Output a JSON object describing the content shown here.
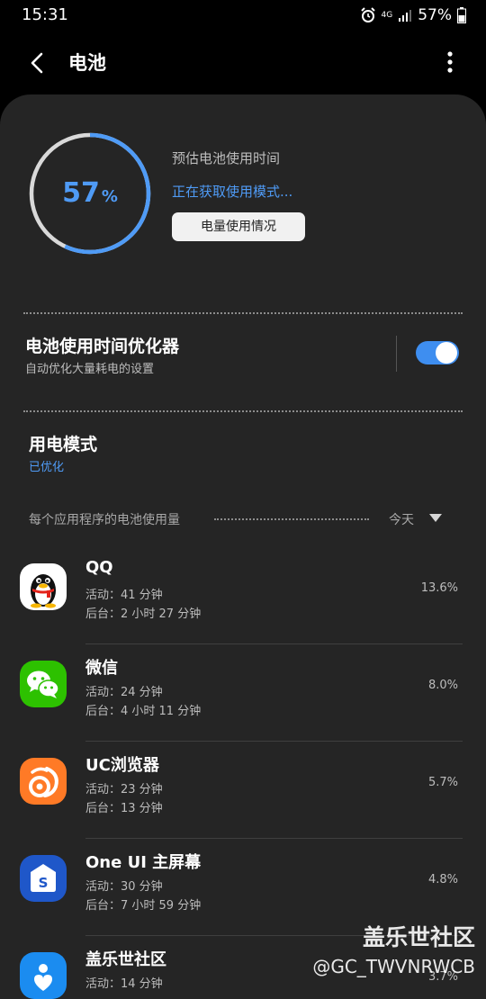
{
  "status_bar": {
    "time": "15:31",
    "network": "4G",
    "battery": "57%"
  },
  "header": {
    "title": "电池",
    "back_icon": "back-chevron-icon",
    "more_icon": "more-vertical-icon"
  },
  "battery": {
    "level_value": "57",
    "level_unit": "%",
    "level_fraction": 0.57,
    "ring_color": "#4f9bf6",
    "estimate_label": "预估电池使用时间",
    "estimate_status": "正在获取使用模式...",
    "usage_button": "电量使用情况"
  },
  "optimizer": {
    "title": "电池使用时间优化器",
    "subtitle": "自动优化大量耗电的设置",
    "enabled": true
  },
  "power_mode": {
    "title": "用电模式",
    "value": "已优化"
  },
  "per_app": {
    "label": "每个应用程序的电池使用量",
    "period": "今天"
  },
  "apps": [
    {
      "name": "QQ",
      "active": "活动：41 分钟",
      "background": "后台：2 小时 27 分钟",
      "percent": "13.6%",
      "icon": "qq-penguin-icon"
    },
    {
      "name": "微信",
      "active": "活动：24 分钟",
      "background": "后台：4 小时 11 分钟",
      "percent": "8.0%",
      "icon": "wechat-icon"
    },
    {
      "name": "UC浏览器",
      "active": "活动：23 分钟",
      "background": "后台：13 分钟",
      "percent": "5.7%",
      "icon": "uc-browser-icon"
    },
    {
      "name": "One UI 主屏幕",
      "active": "活动：30 分钟",
      "background": "后台：7 小时 59 分钟",
      "percent": "4.8%",
      "icon": "oneui-home-icon"
    },
    {
      "name": "盖乐世社区",
      "active": "活动：14 分钟",
      "background": "",
      "percent": "3.7%",
      "icon": "galaxy-community-icon"
    }
  ],
  "watermark": {
    "title": "盖乐世社区",
    "user": "@GC_TWVNRWCB"
  }
}
